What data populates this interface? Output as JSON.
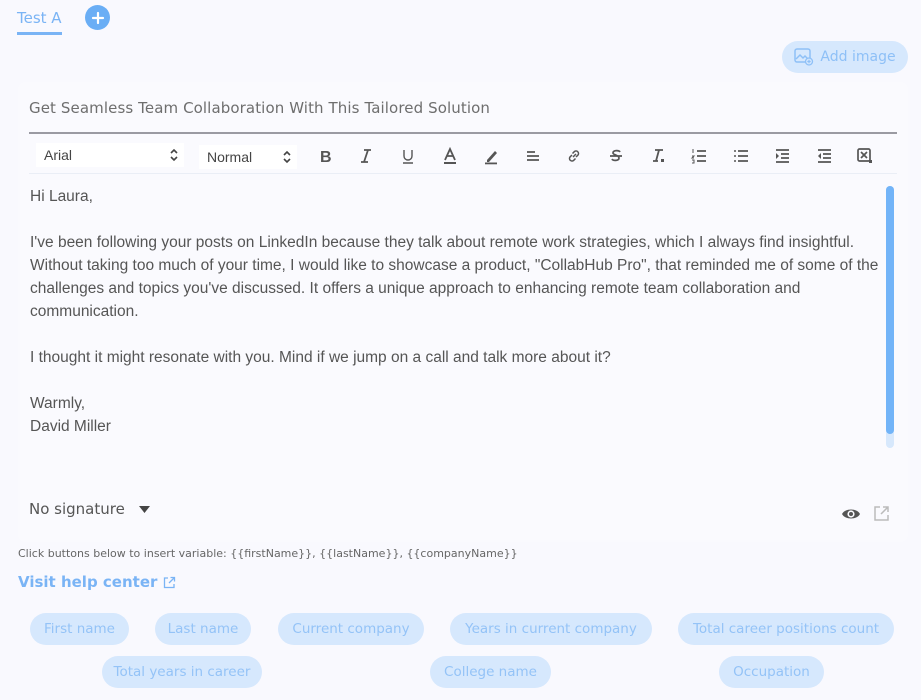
{
  "tabs": [
    {
      "label": "Test A",
      "active": true
    }
  ],
  "add_tab_icon": "plus-circle-icon",
  "add_image": {
    "label": "Add image",
    "icon": "image-add-icon"
  },
  "subject": "Get Seamless Team Collaboration With This Tailored Solution",
  "toolbar": {
    "font": "Arial",
    "size": "Normal",
    "buttons": [
      "bold",
      "italic",
      "underline",
      "font-color",
      "highlight",
      "align",
      "link",
      "strikethrough",
      "clear-format",
      "ordered-list",
      "bullet-list",
      "indent",
      "outdent",
      "remove-format"
    ]
  },
  "body": {
    "greeting": "Hi Laura,",
    "paragraph1": "I've been following your posts on LinkedIn because they talk about remote work strategies, which I always find insightful. Without taking too much of your time, I would like to showcase a product, \"CollabHub Pro\", that reminded me of some of the challenges and topics you've discussed. It offers a unique approach to enhancing remote team collaboration and communication.",
    "paragraph2": "I thought it might resonate with you. Mind if we jump on a call and talk more about it?",
    "closing": "Warmly,",
    "name": "David Miller"
  },
  "signature": {
    "label": "No signature"
  },
  "hint": "Click buttons below to insert variable: {{firstName}}, {{lastName}}, {{companyName}}",
  "help_link": "Visit help center",
  "variables": [
    "First name",
    "Last name",
    "Current company",
    "Years in current company",
    "Total career positions count",
    "Total years in career",
    "College name",
    "Occupation"
  ],
  "colors": {
    "accent": "#6aaef5",
    "chip_bg": "#d6e8fd",
    "chip_text": "#94c3f7",
    "scrollbar": "#72b4f8"
  }
}
